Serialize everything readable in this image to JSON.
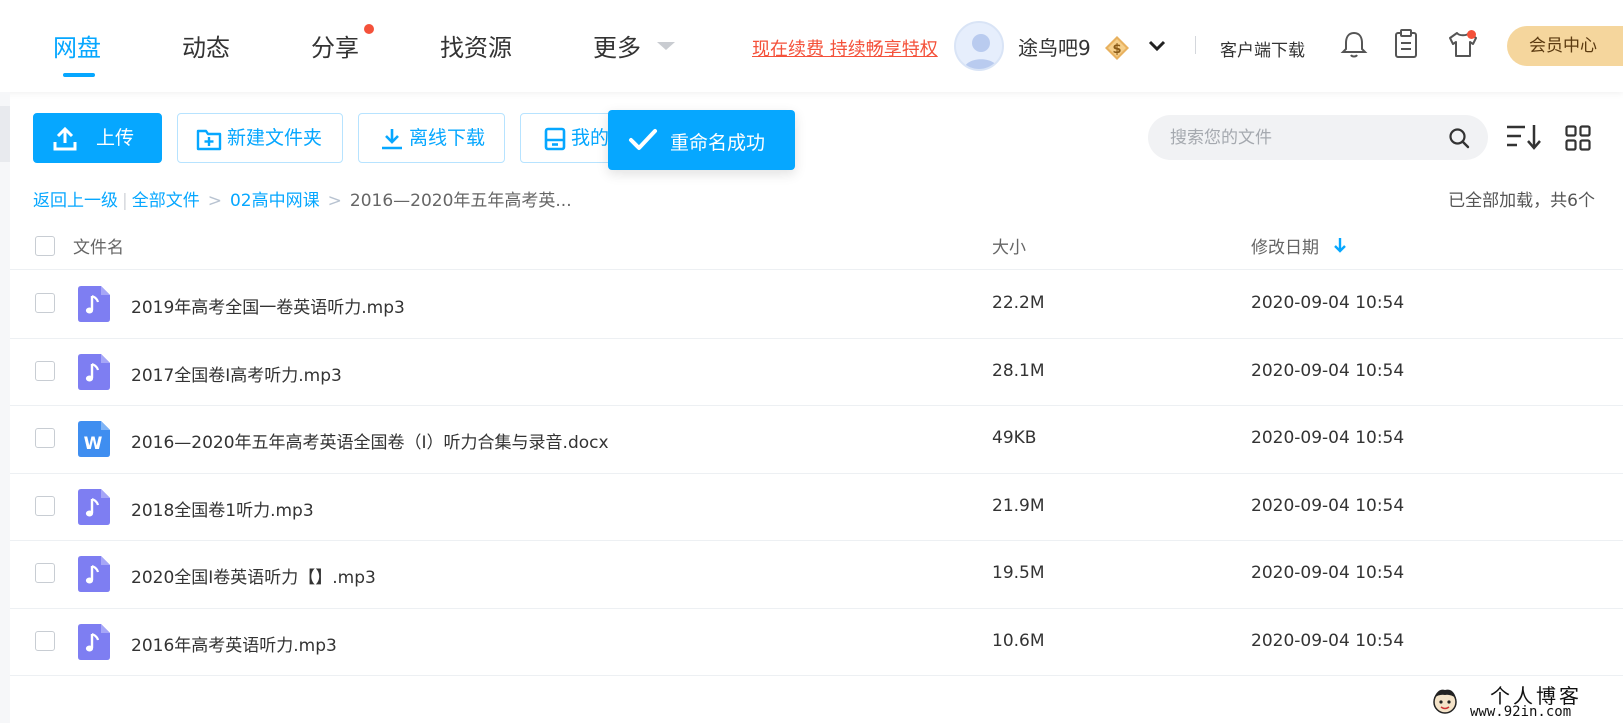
{
  "nav": {
    "tabs": [
      {
        "label": "网盘",
        "active": true
      },
      {
        "label": "动态",
        "active": false
      },
      {
        "label": "分享",
        "active": false,
        "badge_dot": true
      },
      {
        "label": "找资源",
        "active": false
      },
      {
        "label": "更多",
        "active": false,
        "dropdown": true
      }
    ],
    "renew_link": "现在续费 持续畅享特权",
    "username": "途鸟吧9",
    "vip_badge_symbol": "$",
    "client_download": "客户端下载",
    "vip_center": "会员中心",
    "accent_color": "#06a7ff",
    "dot_color": "#f4513a"
  },
  "toolbar": {
    "upload": "上传",
    "new_folder": "新建文件夹",
    "offline_download": "离线下载",
    "my_device": "我的",
    "search_placeholder": "搜索您的文件"
  },
  "toast": {
    "message": "重命名成功"
  },
  "breadcrumb": {
    "back": "返回上一级",
    "all_files": "全部文件",
    "folder": "02高中网课",
    "current": "2016—2020年五年高考英...",
    "load_status": "已全部加载，共6个"
  },
  "table": {
    "headers": {
      "name": "文件名",
      "size": "大小",
      "date": "修改日期"
    },
    "rows": [
      {
        "name": "2019年高考全国一卷英语听力.mp3",
        "size": "22.2M",
        "date": "2020-09-04 10:54",
        "type": "audio-icon"
      },
      {
        "name": "2017全国卷I高考听力.mp3",
        "size": "28.1M",
        "date": "2020-09-04 10:54",
        "type": "audio-icon"
      },
      {
        "name": "2016—2020年五年高考英语全国卷（I）听力合集与录音.docx",
        "size": "49KB",
        "date": "2020-09-04 10:54",
        "type": "word-doc-icon",
        "icon_letter": "W"
      },
      {
        "name": "2018全国卷1听力.mp3",
        "size": "21.9M",
        "date": "2020-09-04 10:54",
        "type": "audio-icon"
      },
      {
        "name": "2020全国Ⅰ卷英语听力【】.mp3",
        "size": "19.5M",
        "date": "2020-09-04 10:54",
        "type": "audio-icon"
      },
      {
        "name": "2016年高考英语听力.mp3",
        "size": "10.6M",
        "date": "2020-09-04 10:54",
        "type": "audio-icon"
      }
    ]
  },
  "watermark": {
    "title": "个人博客",
    "url": "www.92in.com"
  }
}
